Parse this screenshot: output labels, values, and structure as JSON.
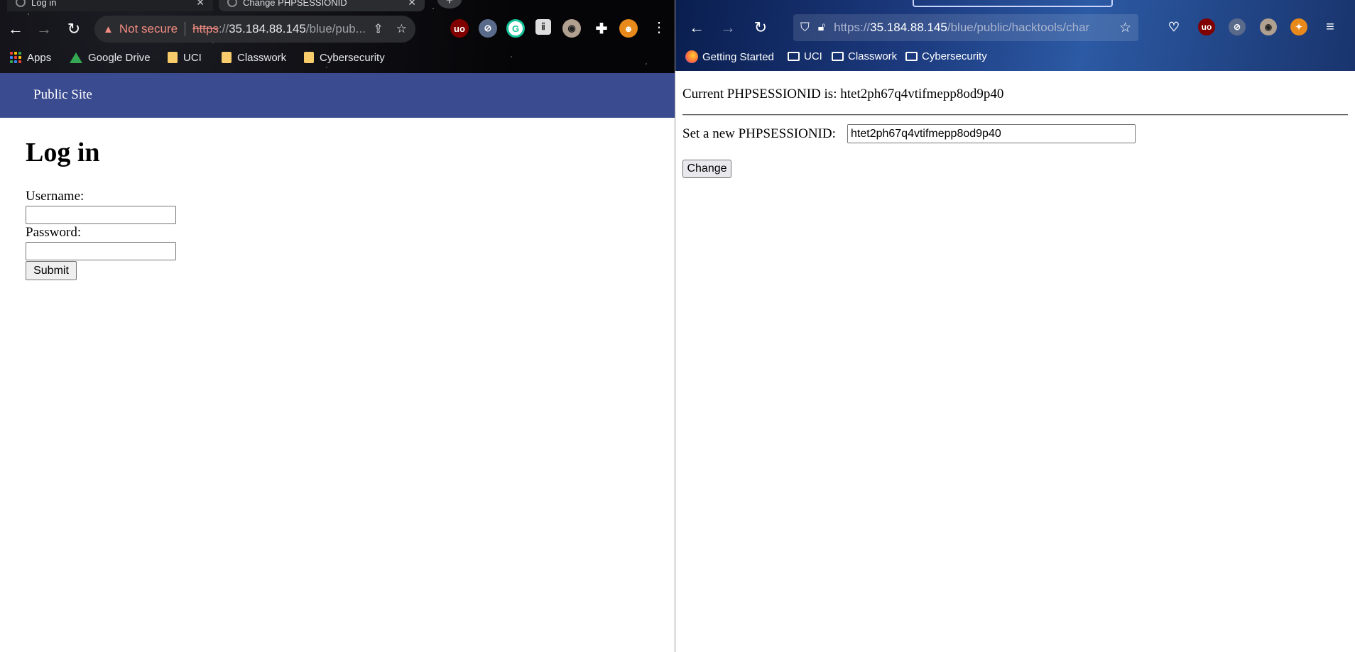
{
  "chrome": {
    "tabs": [
      {
        "label": "Log in"
      },
      {
        "label": "Change PHPSESSIONID"
      }
    ],
    "newtab_label": "+",
    "address": {
      "warning": "Not secure",
      "protocol": "https",
      "protocol_rest": "://",
      "host": "35.184.88.145",
      "path": "/blue/pub..."
    },
    "bookmarks": [
      {
        "label": "Apps"
      },
      {
        "label": "Google Drive"
      },
      {
        "label": "UCI"
      },
      {
        "label": "Classwork"
      },
      {
        "label": "Cybersecurity"
      }
    ],
    "extensions": [
      "ublock-icon",
      "privacy-icon",
      "grammarly-icon",
      "tab-icon",
      "owl-icon",
      "puzzle-icon",
      "profile-avatar"
    ],
    "page": {
      "site_name": "Public Site",
      "heading": "Log in",
      "username_label": "Username:",
      "username_value": "",
      "password_label": "Password:",
      "password_value": "",
      "submit_label": "Submit"
    }
  },
  "firefox": {
    "address": {
      "protocol": "https://",
      "host": "35.184.88.145",
      "path": "/blue/public/hacktools/char"
    },
    "bookmarks": [
      {
        "label": "Getting Started"
      },
      {
        "label": "UCI"
      },
      {
        "label": "Classwork"
      },
      {
        "label": "Cybersecurity"
      }
    ],
    "page": {
      "current_label": "Current PHPSESSIONID is:",
      "current_value": "htet2ph67q4vtifmepp8od9p40",
      "set_label": "Set a new PHPSESSIONID:",
      "input_value": "htet2ph67q4vtifmepp8od9p40",
      "button_label": "Change"
    }
  },
  "colors": {
    "chrome_navbar": "#3b4b8f",
    "not_secure": "#f28b82"
  }
}
